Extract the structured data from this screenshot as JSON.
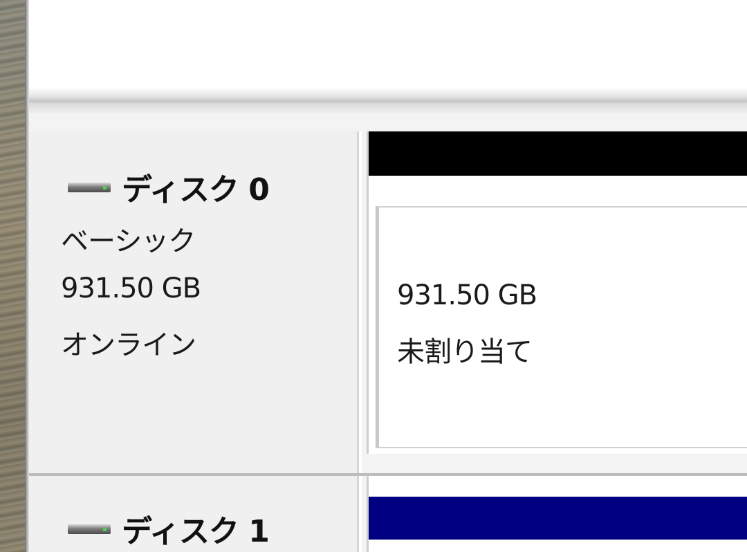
{
  "disks": [
    {
      "name": "ディスク 0",
      "type": "ベーシック",
      "size": "931.50 GB",
      "status": "オンライン",
      "partition": {
        "size": "931.50 GB",
        "state": "未割り当て",
        "bar_color": "#000000"
      }
    },
    {
      "name": "ディスク 1",
      "partition": {
        "bar_color": "#000080"
      }
    }
  ],
  "icons": {
    "drive": "hard-drive-icon"
  }
}
